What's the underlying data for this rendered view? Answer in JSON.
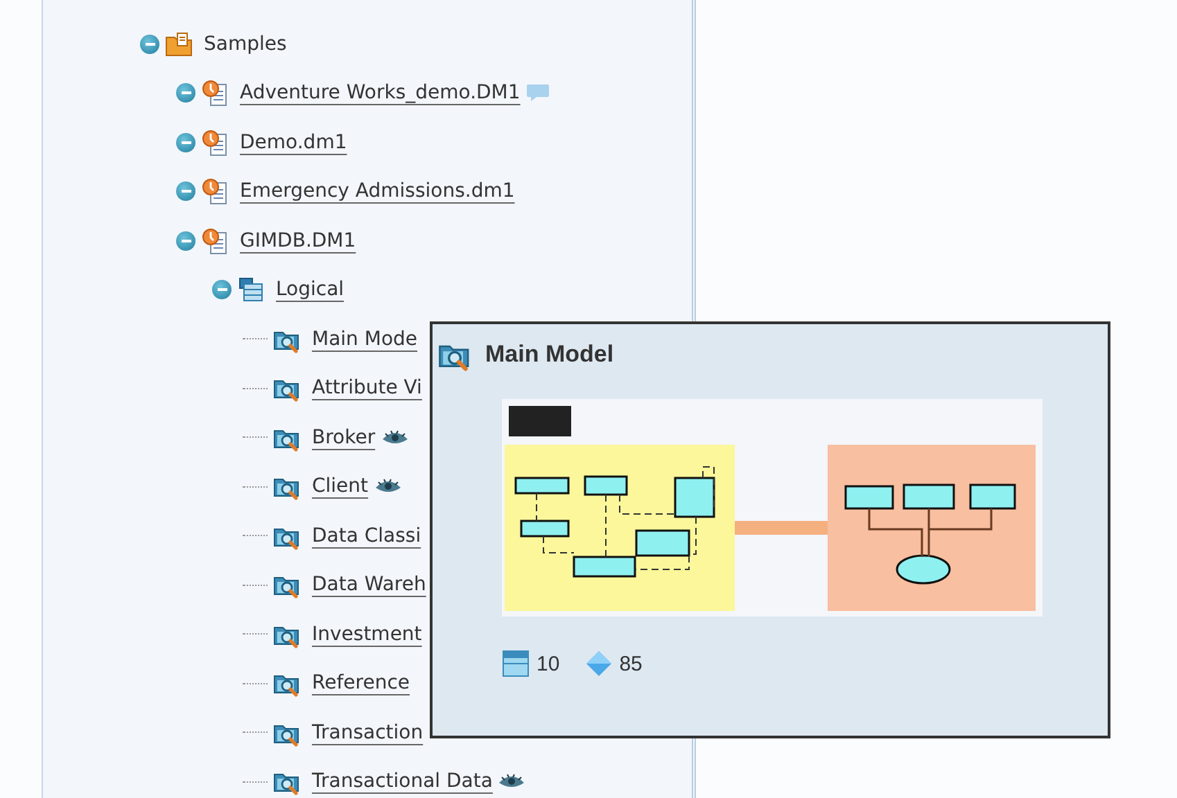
{
  "tree": [
    {
      "label": "Samples",
      "kind": "folder",
      "expanded": true,
      "children": [
        {
          "label": "Adventure Works_demo.DM1",
          "kind": "model",
          "expanded": true,
          "underlined": true,
          "has_comment": true
        },
        {
          "label": "Demo.dm1",
          "kind": "model",
          "expanded": true,
          "underlined": true
        },
        {
          "label": "Emergency Admissions.dm1",
          "kind": "model",
          "expanded": true,
          "underlined": true
        },
        {
          "label": "GIMDB.DM1",
          "kind": "model",
          "expanded": true,
          "underlined": true,
          "children": [
            {
              "label": "Logical",
              "kind": "logical",
              "expanded": true,
              "underlined": true,
              "children": [
                {
                  "label": "Main Mode",
                  "kind": "diagram",
                  "underlined": true
                },
                {
                  "label": "Attribute Vi",
                  "kind": "diagram",
                  "underlined": true
                },
                {
                  "label": "Broker",
                  "kind": "diagram",
                  "underlined": true,
                  "watched": true
                },
                {
                  "label": "Client",
                  "kind": "diagram",
                  "underlined": true,
                  "watched": true
                },
                {
                  "label": "Data Classi",
                  "kind": "diagram",
                  "underlined": true
                },
                {
                  "label": "Data Wareh",
                  "kind": "diagram",
                  "underlined": true
                },
                {
                  "label": "Investment",
                  "kind": "diagram",
                  "underlined": true
                },
                {
                  "label": "Reference",
                  "kind": "diagram",
                  "underlined": true
                },
                {
                  "label": "Transaction",
                  "kind": "diagram",
                  "underlined": true
                },
                {
                  "label": "Transactional Data",
                  "kind": "diagram",
                  "underlined": true,
                  "watched": true
                }
              ]
            }
          ]
        }
      ]
    }
  ],
  "popup": {
    "title": "Main Model",
    "stats": [
      {
        "kind": "entities",
        "value": "10"
      },
      {
        "kind": "relationships",
        "value": "85"
      }
    ]
  }
}
